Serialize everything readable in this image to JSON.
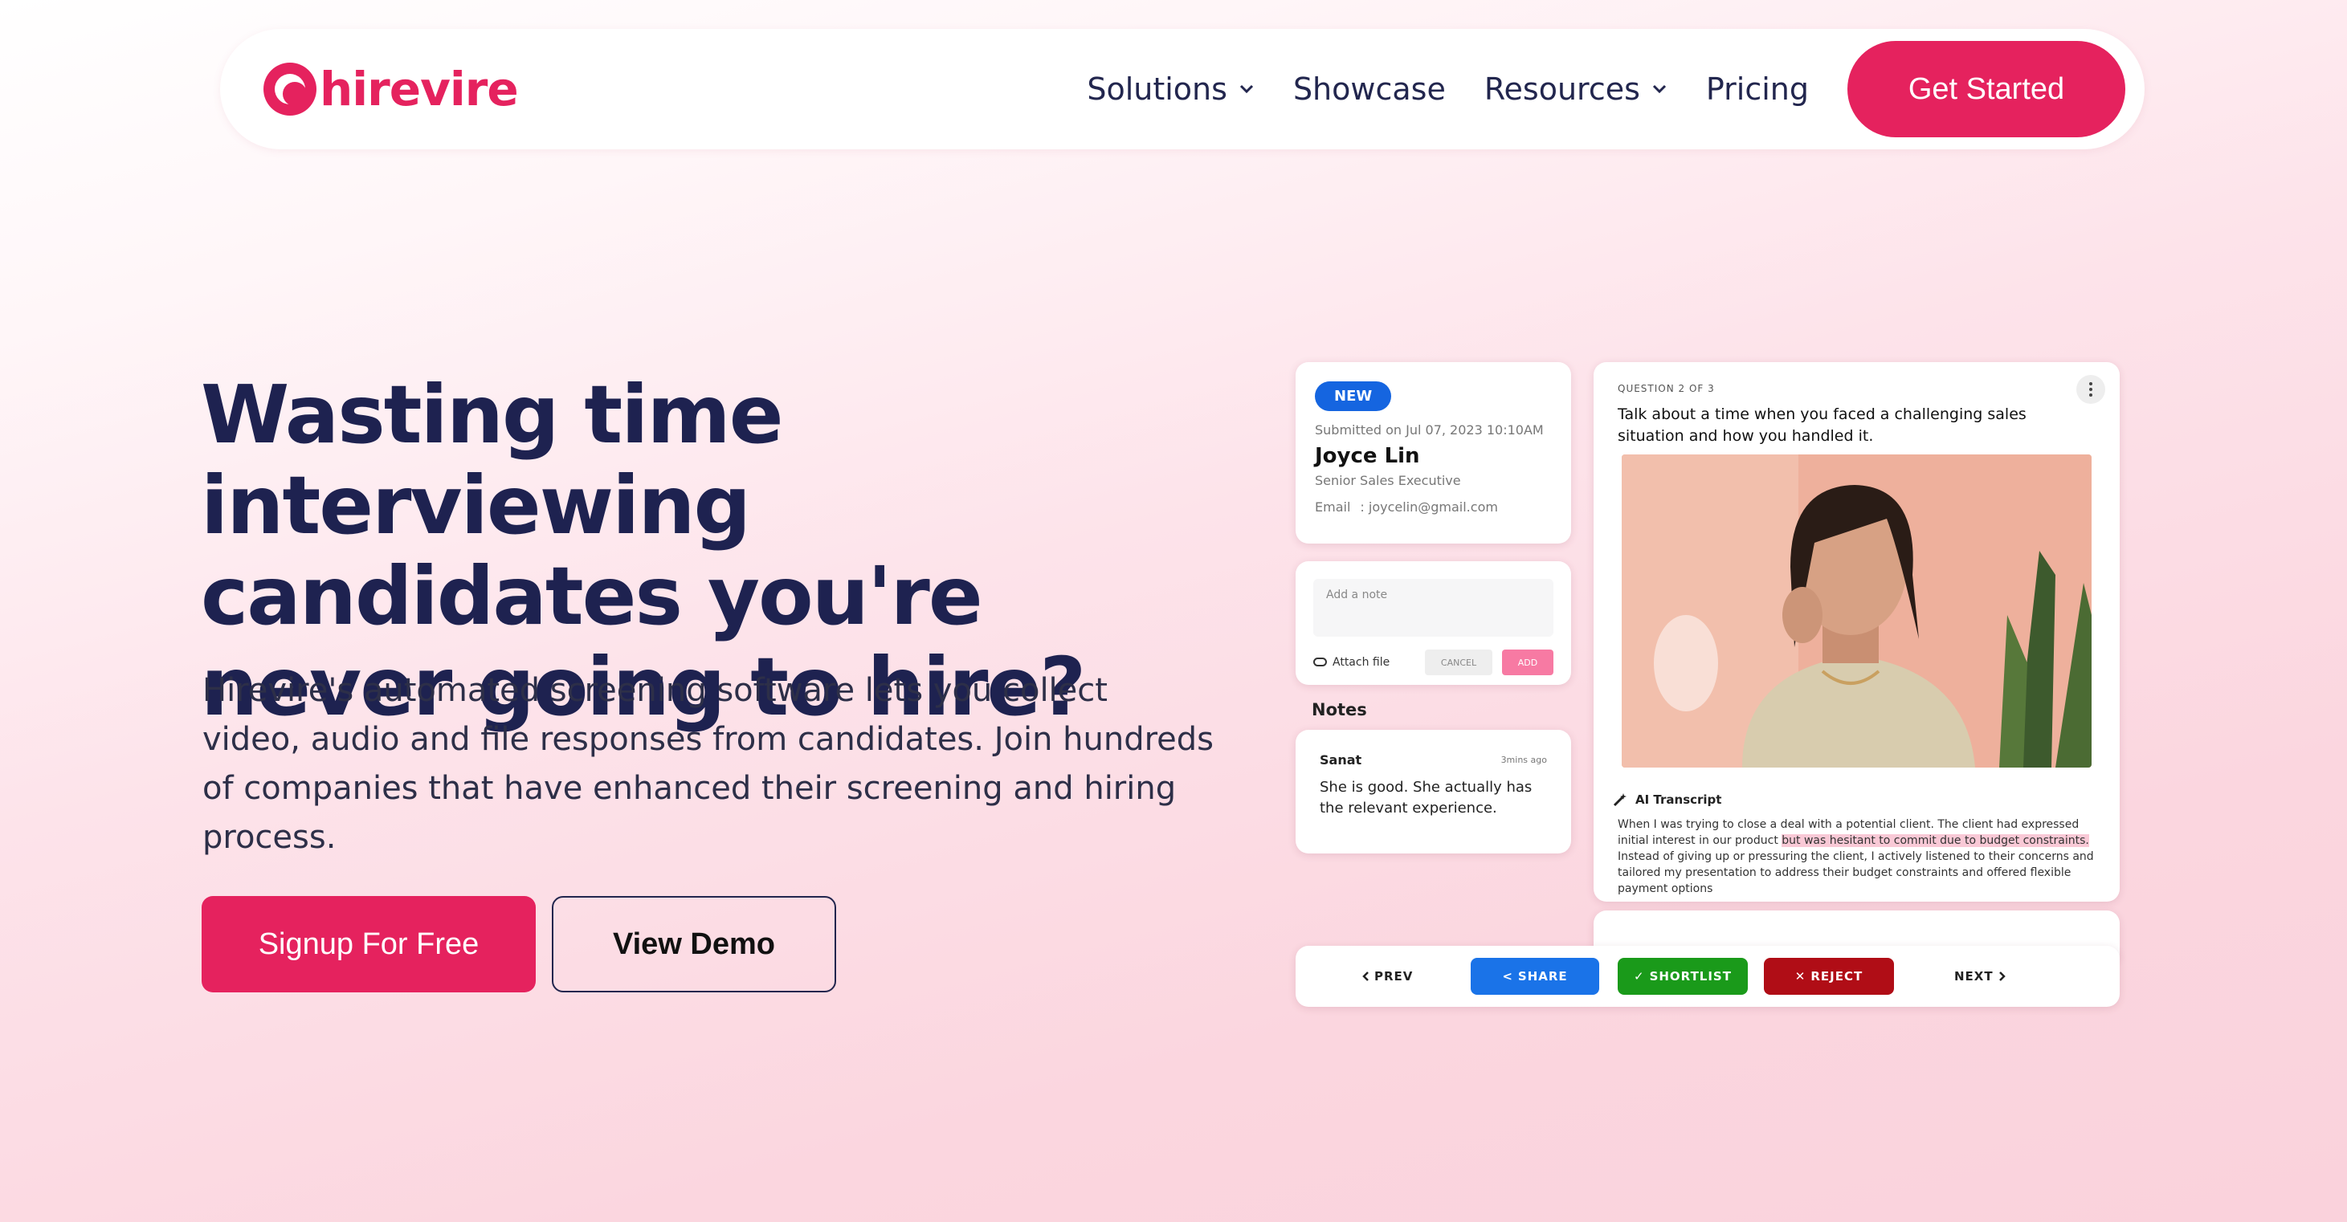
{
  "brand": {
    "name": "hirevire",
    "color": "#e5225e"
  },
  "nav": {
    "items": [
      {
        "label": "Solutions",
        "dropdown": true
      },
      {
        "label": "Showcase",
        "dropdown": false
      },
      {
        "label": "Resources",
        "dropdown": true
      },
      {
        "label": "Pricing",
        "dropdown": false
      }
    ],
    "cta": "Get Started"
  },
  "hero": {
    "title": "Wasting time interviewing candidates you're never going to hire?",
    "description": "Hirevire's automated screening software lets you collect video, audio and file responses from candidates. Join hundreds of companies that have enhanced their screening and hiring process.",
    "primary_button": "Signup For Free",
    "secondary_button": "View Demo"
  },
  "mockup": {
    "candidate": {
      "badge": "NEW",
      "submitted": "Submitted on Jul 07, 2023 10:10AM",
      "name": "Joyce Lin",
      "role": "Senior Sales Executive",
      "email_label": "Email",
      "email": ": joycelin@gmail.com"
    },
    "note_box": {
      "placeholder": "Add a note",
      "attach": "Attach file",
      "cancel": "CANCEL",
      "add": "ADD"
    },
    "notes": {
      "heading": "Notes",
      "author": "Sanat",
      "time": "3mins ago",
      "text": "She is good. She actually has the relevant experience."
    },
    "question": {
      "counter": "QUESTION 2 OF 3",
      "text": "Talk about a time when you faced a challenging sales situation and how you handled it.",
      "transcript_heading": "AI Transcript",
      "transcript_pre": "When I was trying to close a deal with a potential client. The client had expressed initial interest in our product ",
      "transcript_highlight": "but was hesitant to commit due to budget constraints.",
      "transcript_post": " Instead of giving up or pressuring the client, I actively listened to their concerns and tailored my presentation to address their budget constraints and offered flexible payment options"
    },
    "footer": {
      "prev": "PREV",
      "share": "SHARE",
      "shortlist": "SHORTLIST",
      "reject": "REJECT",
      "next": "NEXT",
      "share_color": "#1a73e8",
      "shortlist_color": "#1a9a1a",
      "reject_color": "#b00d16"
    }
  }
}
